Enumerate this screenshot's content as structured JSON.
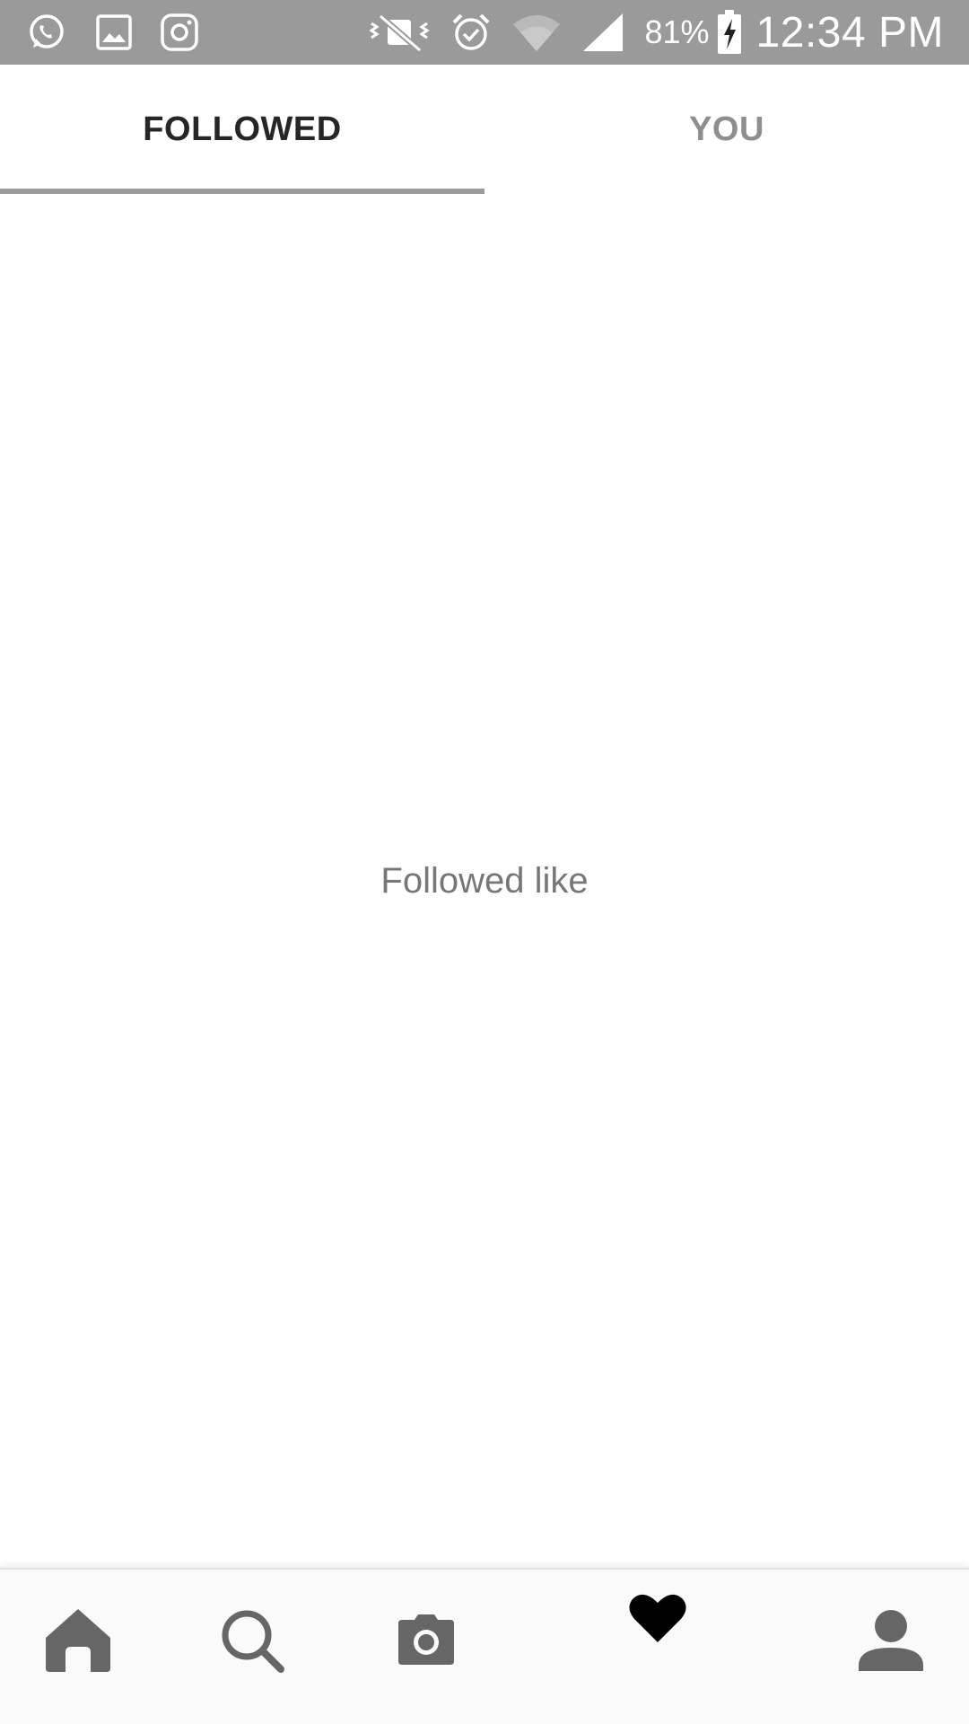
{
  "status_bar": {
    "left_icons": [
      "whatsapp-icon",
      "gallery-icon",
      "instagram-icon"
    ],
    "right_icons": [
      "vibrate-mute-icon",
      "alarm-icon",
      "wifi-icon",
      "signal-icon",
      "battery-charging-icon"
    ],
    "battery_percent": "81%",
    "time": "12:34 PM",
    "background_color": "#9a9a9a"
  },
  "tabs": [
    {
      "label": "FOLLOWED",
      "active": true
    },
    {
      "label": "YOU",
      "active": false
    }
  ],
  "content": {
    "empty_message": "Followed like"
  },
  "bottom_nav": {
    "items": [
      {
        "icon": "home-icon",
        "active": false
      },
      {
        "icon": "search-icon",
        "active": false
      },
      {
        "icon": "camera-icon",
        "active": false
      },
      {
        "icon": "heart-icon",
        "active": true
      },
      {
        "icon": "profile-icon",
        "active": false
      }
    ]
  }
}
